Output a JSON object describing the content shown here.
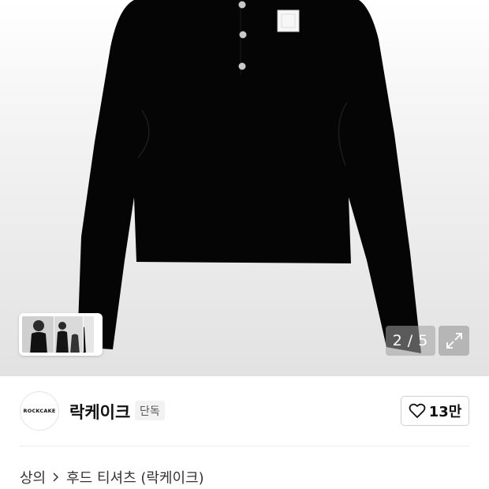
{
  "gallery": {
    "current": "2",
    "separator": "/",
    "total": "5"
  },
  "brand": {
    "logo_text": "ROCKCAKE",
    "name": "락케이크",
    "badge": "단독",
    "like_count": "13만"
  },
  "breadcrumb": {
    "category": "상의",
    "subcategory": "후드 티셔츠 (락케이크)"
  },
  "icons": {
    "thumb_next": "chevron-right-icon",
    "expand": "expand-arrows-icon",
    "like": "heart-outline-icon",
    "breadcrumb_sep": "chevron-right-icon"
  },
  "colors": {
    "garment": "#050505",
    "badge_bg": "#f2f2f2",
    "counter_bg": "#a0a0a0"
  }
}
